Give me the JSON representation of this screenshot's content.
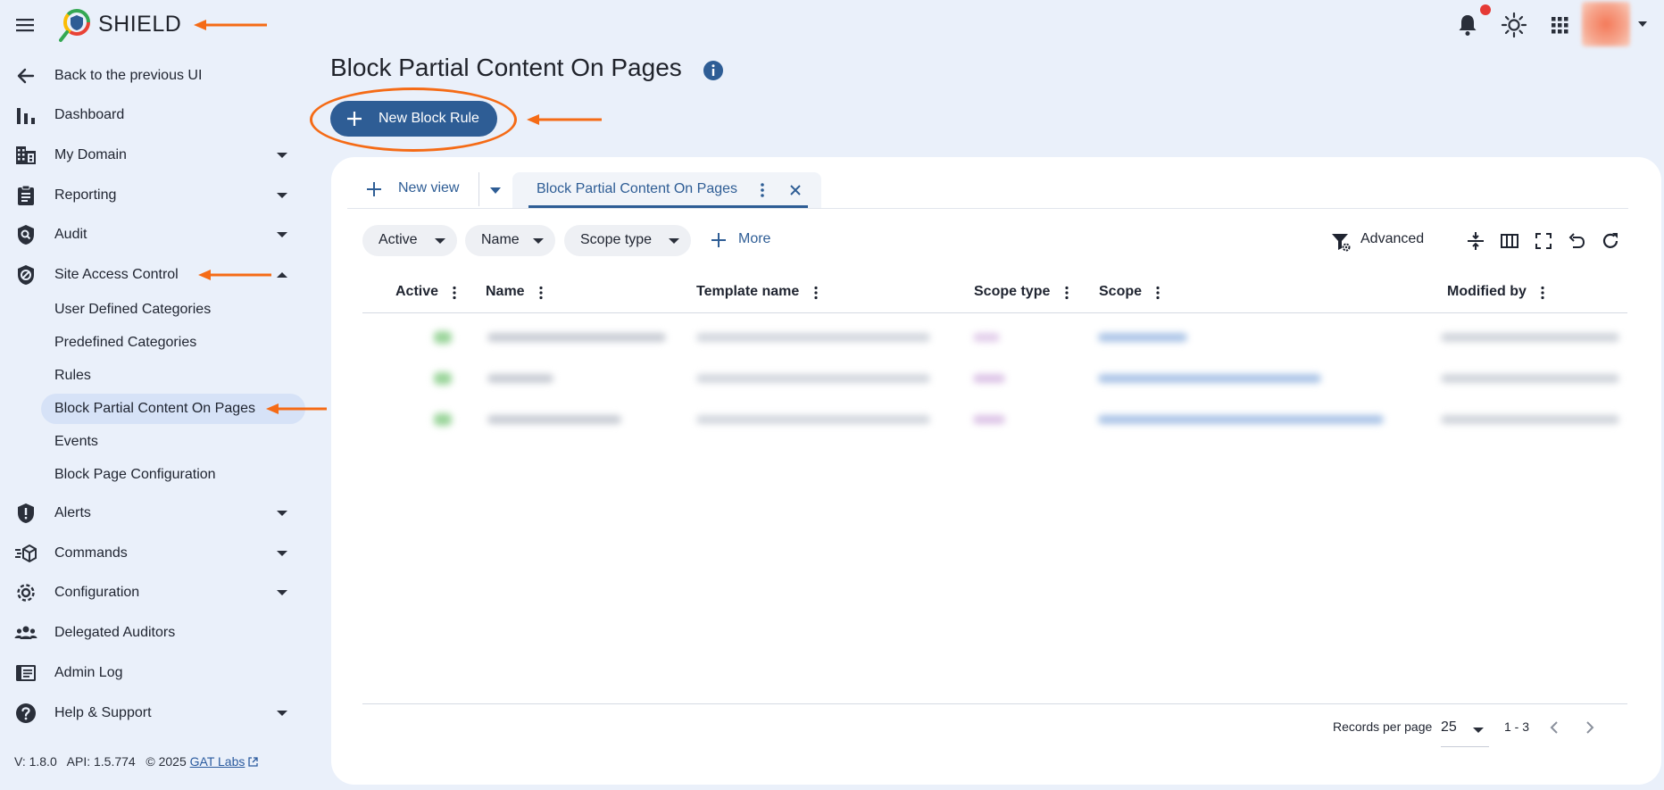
{
  "app": {
    "title": "SHIELD"
  },
  "sidebar": {
    "back_label": "Back to the previous UI",
    "items": [
      {
        "label": "Dashboard",
        "icon": "bar-chart-icon"
      },
      {
        "label": "My Domain",
        "icon": "building-icon"
      },
      {
        "label": "Reporting",
        "icon": "clipboard-icon"
      },
      {
        "label": "Audit",
        "icon": "shield-search-icon"
      },
      {
        "label": "Site Access Control",
        "icon": "shield-lock-icon"
      },
      {
        "label": "Alerts",
        "icon": "shield-alert-icon"
      },
      {
        "label": "Commands",
        "icon": "cube-send-icon"
      },
      {
        "label": "Configuration",
        "icon": "gear-icon"
      },
      {
        "label": "Delegated Auditors",
        "icon": "people-icon"
      },
      {
        "label": "Admin Log",
        "icon": "log-book-icon"
      },
      {
        "label": "Help & Support",
        "icon": "help-icon"
      }
    ],
    "sub_items": [
      {
        "label": "User Defined Categories"
      },
      {
        "label": "Predefined Categories"
      },
      {
        "label": "Rules"
      },
      {
        "label": "Block Partial Content On Pages",
        "selected": true
      },
      {
        "label": "Events"
      },
      {
        "label": "Block Page Configuration"
      }
    ]
  },
  "footer": {
    "version": "V: 1.8.0",
    "api": "API: 1.5.774",
    "copyright": "© 2025",
    "link": "GAT Labs"
  },
  "main": {
    "title": "Block Partial Content On Pages",
    "new_button": "New Block Rule",
    "new_view": "New view",
    "active_tab": "Block Partial Content On Pages",
    "filters": [
      "Active",
      "Name",
      "Scope type"
    ],
    "more": "More",
    "advanced": "Advanced",
    "columns": [
      "Active",
      "Name",
      "Template name",
      "Scope type",
      "Scope",
      "Modified by"
    ],
    "pagination": {
      "records_label": "Records per page",
      "per_page": "25",
      "range": "1 - 3"
    }
  },
  "colors": {
    "accent": "#2e5d95",
    "annotation": "#f56b16",
    "background": "#eaf0fa"
  }
}
